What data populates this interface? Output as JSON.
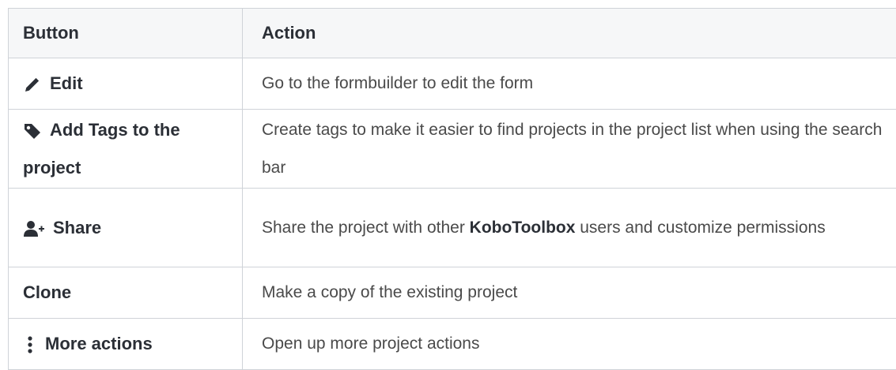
{
  "table": {
    "headers": {
      "button": "Button",
      "action": "Action"
    },
    "rows": [
      {
        "button_label": "Edit",
        "icon": "pencil-icon",
        "action": "Go to the formbuilder to edit the form"
      },
      {
        "button_label": "Add Tags to the project",
        "icon": "tag-icon",
        "action": "Create tags to make it easier to find projects in the project list when using the search bar"
      },
      {
        "button_label": "Share",
        "icon": "user-plus-icon",
        "action_parts": {
          "before": "Share the project with other ",
          "brand": "KoboToolbox",
          "after": " users and customize permissions"
        }
      },
      {
        "button_label": "Clone",
        "action": "Make a copy of the existing project"
      },
      {
        "button_label": "More actions",
        "icon": "vertical-dots-icon",
        "action": "Open up more project actions"
      }
    ]
  },
  "colors": {
    "text": "#2b2f36",
    "body_text": "#4a4a4a",
    "border": "#cfd3d8",
    "header_bg": "#f6f7f8"
  }
}
